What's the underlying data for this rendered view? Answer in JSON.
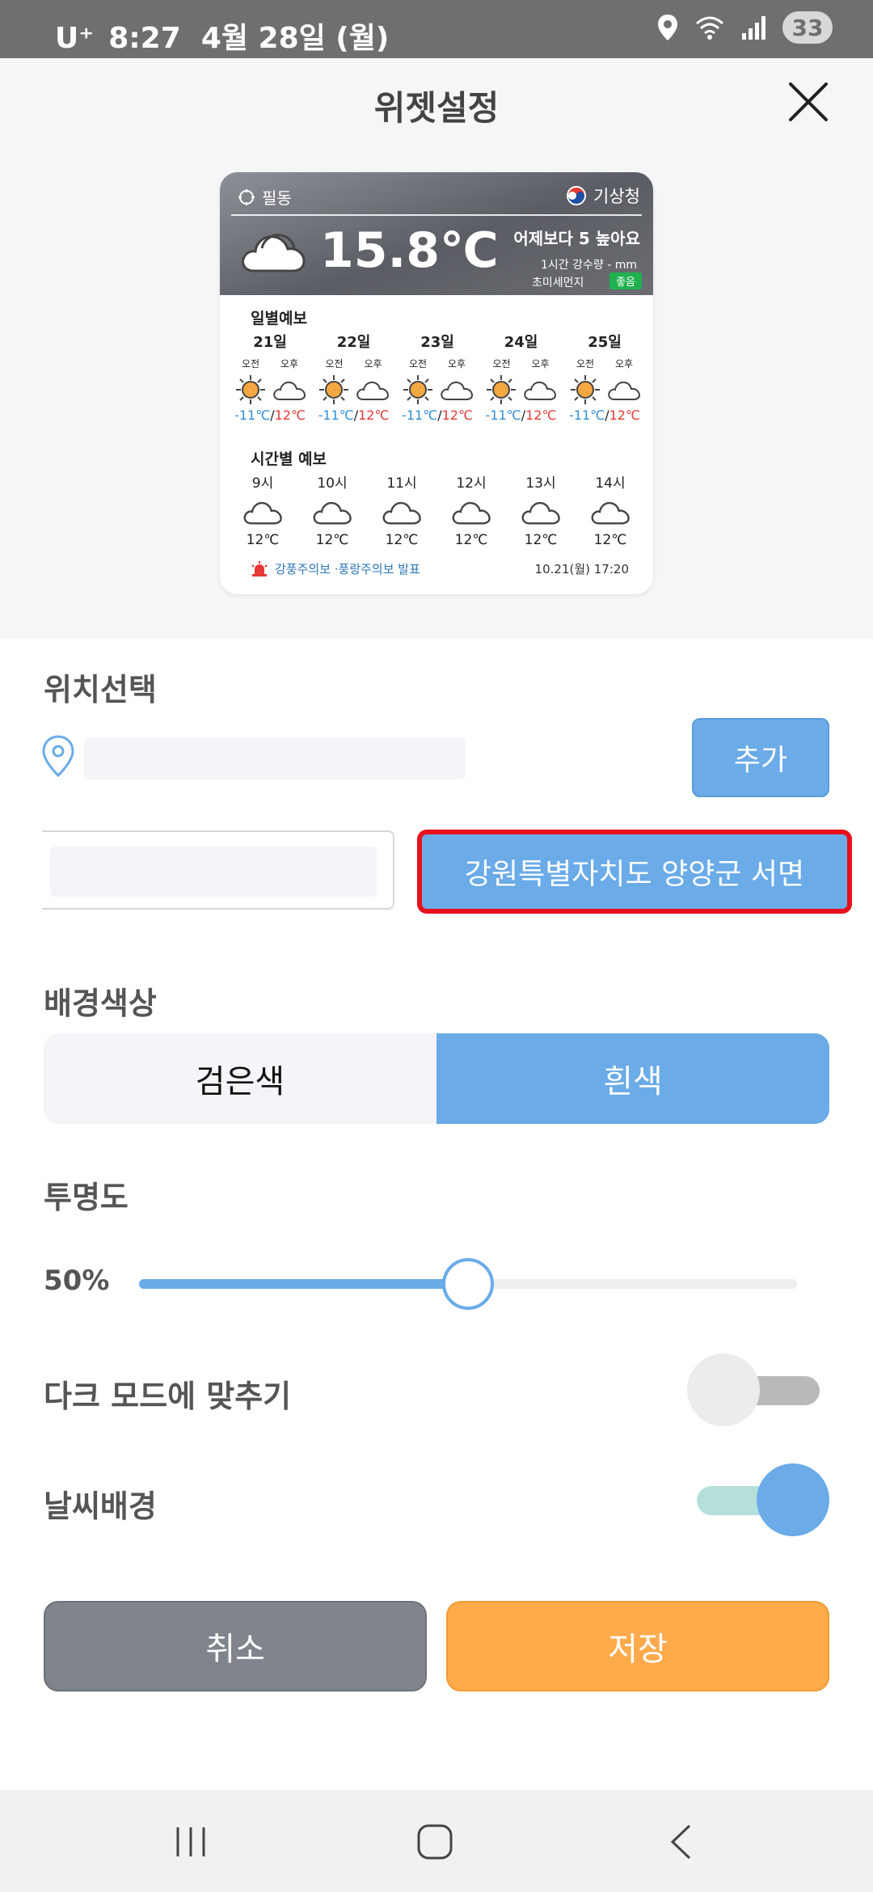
{
  "status_bar": {
    "carrier": "U⁺",
    "time": "8:27",
    "date": "4월 28일 (월)",
    "battery": "33"
  },
  "header": {
    "title": "위젯설정"
  },
  "widget_preview": {
    "location": "필동",
    "agency": "기상청",
    "temperature": "15.8℃",
    "compare": "어제보다 5 높아요",
    "rain": "1시간 강수량 - mm",
    "dust_label": "초미세먼지",
    "dust_status": "좋음",
    "daily_title": "일별예보",
    "am_label": "오전",
    "pm_label": "오후",
    "days": [
      {
        "date": "21일",
        "low": "-11℃",
        "high": "12℃"
      },
      {
        "date": "22일",
        "low": "-11℃",
        "high": "12℃"
      },
      {
        "date": "23일",
        "low": "-11℃",
        "high": "12℃"
      },
      {
        "date": "24일",
        "low": "-11℃",
        "high": "12℃"
      },
      {
        "date": "25일",
        "low": "-11℃",
        "high": "12℃"
      }
    ],
    "hourly_title": "시간별 예보",
    "hours": [
      {
        "time": "9시",
        "temp": "12℃"
      },
      {
        "time": "10시",
        "temp": "12℃"
      },
      {
        "time": "11시",
        "temp": "12℃"
      },
      {
        "time": "12시",
        "temp": "12℃"
      },
      {
        "time": "13시",
        "temp": "12℃"
      },
      {
        "time": "14시",
        "temp": "12℃"
      }
    ],
    "warning": "강풍주의보 ·풍랑주의보 발표",
    "updated": "10.21(월) 17:20",
    "slash": "/"
  },
  "location_section": {
    "label": "위치선택",
    "search_value": "",
    "add_button": "추가",
    "selected_location": "강원특별자치도 양양군 서면"
  },
  "background_section": {
    "label": "배경색상",
    "options": [
      "검은색",
      "흰색"
    ],
    "selected": "흰색"
  },
  "transparency_section": {
    "label": "투명도",
    "value_text": "50%",
    "value": 0.5
  },
  "dark_mode": {
    "label": "다크 모드에 맞추기",
    "enabled": false
  },
  "weather_background": {
    "label": "날씨배경",
    "enabled": true
  },
  "actions": {
    "cancel": "취소",
    "save": "저장"
  },
  "colors": {
    "accent": "#6aabe8",
    "save": "#ffab4c",
    "cancel": "#80848c",
    "highlight_border": "#e8101c"
  }
}
